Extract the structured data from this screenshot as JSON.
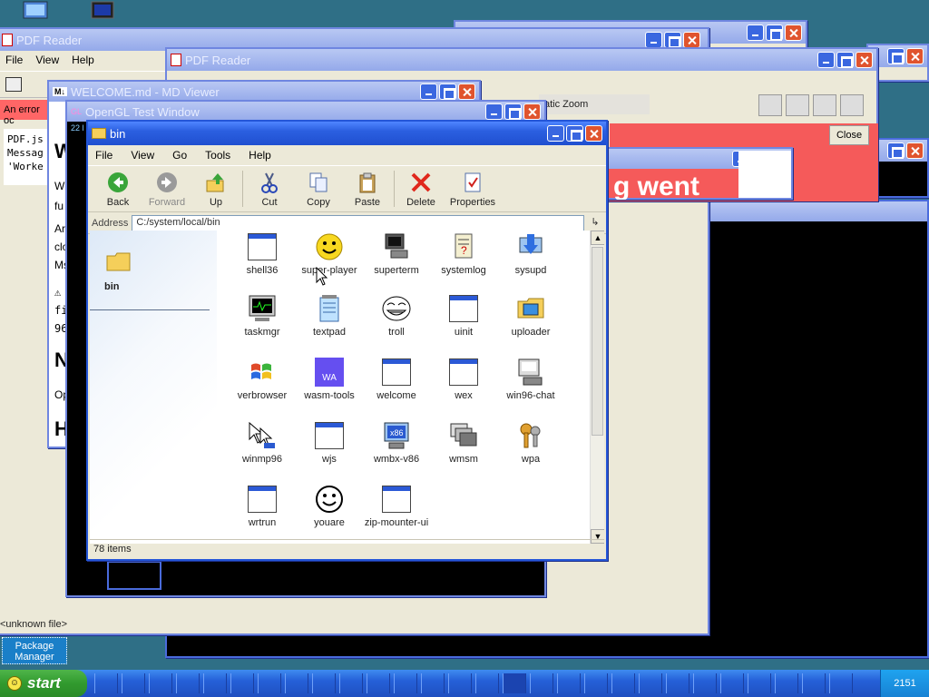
{
  "taskbar": {
    "start_label": "start",
    "clock": "2151"
  },
  "package_manager": {
    "label": "Package Manager"
  },
  "windows": {
    "pdf1": {
      "title": "PDF Reader",
      "menu": [
        "File",
        "View",
        "Help"
      ],
      "error_text": "An error oc",
      "code_lines": [
        "PDF.js",
        "Messag",
        "'Worke"
      ]
    },
    "pdf2": {
      "title": "PDF Reader",
      "zoom_text": "atic Zoom",
      "close_label": "Close",
      "banner_text": "g went"
    },
    "welcome": {
      "title": "WELCOME.md - MD Viewer",
      "heading1": "W",
      "body1": [
        "W",
        "fu"
      ],
      "body2": [
        "Ar",
        "clo",
        "Ms"
      ],
      "body3": [
        "⚠",
        "fi",
        "96"
      ],
      "heading2": "N",
      "body4": "Op",
      "heading3": "H"
    },
    "opengl": {
      "title": "OpenGL Test Window",
      "counter": "22 l"
    },
    "unknown": {
      "label": "<unknown file>"
    }
  },
  "explorer": {
    "title": "bin",
    "menu": [
      "File",
      "View",
      "Go",
      "Tools",
      "Help"
    ],
    "toolbar": {
      "back": "Back",
      "forward": "Forward",
      "up": "Up",
      "cut": "Cut",
      "copy": "Copy",
      "paste": "Paste",
      "delete": "Delete",
      "properties": "Properties"
    },
    "address_label": "Address",
    "address_value": "C:/system/local/bin",
    "folder_label": "bin",
    "items": [
      {
        "label": "shell36",
        "icon": "window-icon"
      },
      {
        "label": "super-player",
        "icon": "smiley-icon"
      },
      {
        "label": "superterm",
        "icon": "terminal-icon"
      },
      {
        "label": "systemlog",
        "icon": "log-icon"
      },
      {
        "label": "sysupd",
        "icon": "update-icon"
      },
      {
        "label": "taskmgr",
        "icon": "taskmgr-icon"
      },
      {
        "label": "textpad",
        "icon": "notepad-icon"
      },
      {
        "label": "troll",
        "icon": "troll-face-icon"
      },
      {
        "label": "uinit",
        "icon": "window-icon"
      },
      {
        "label": "uploader",
        "icon": "uploader-icon"
      },
      {
        "label": "verbrowser",
        "icon": "windows-flag-icon"
      },
      {
        "label": "wasm-tools",
        "icon": "wasm-icon",
        "icon_text": "WA"
      },
      {
        "label": "welcome",
        "icon": "window-icon"
      },
      {
        "label": "wex",
        "icon": "window-icon"
      },
      {
        "label": "win96-chat",
        "icon": "chat-icon"
      },
      {
        "label": "winmp96",
        "icon": "cursor-icon"
      },
      {
        "label": "wjs",
        "icon": "window-icon"
      },
      {
        "label": "wmbx-v86",
        "icon": "x86-computer-icon",
        "icon_text": "x86"
      },
      {
        "label": "wmsm",
        "icon": "windows-stack-icon"
      },
      {
        "label": "wpa",
        "icon": "keys-icon"
      },
      {
        "label": "wrtrun",
        "icon": "window-icon"
      },
      {
        "label": "youare",
        "icon": "smiley-outline-icon"
      },
      {
        "label": "zip-mounter-ui",
        "icon": "window-icon"
      }
    ],
    "status": "78 items"
  }
}
